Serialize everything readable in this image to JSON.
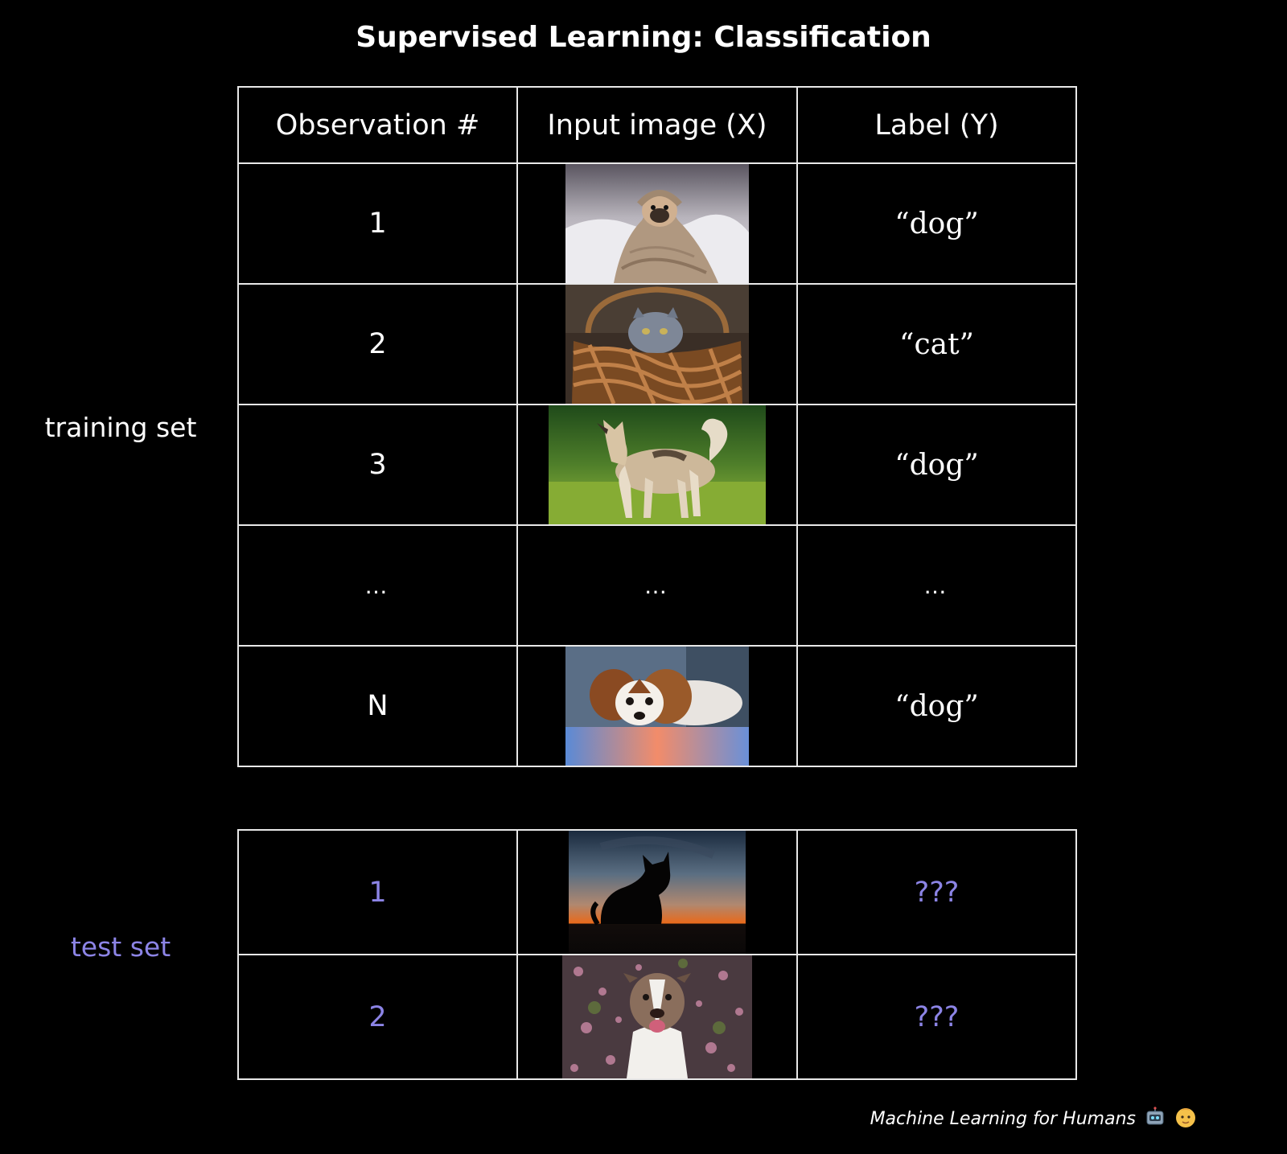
{
  "title": "Supervised Learning: Classification",
  "side_labels": {
    "training": "training set",
    "test": "test set"
  },
  "headers": {
    "observation": "Observation #",
    "input": "Input image (X)",
    "label": "Label (Y)"
  },
  "training_rows": [
    {
      "obs": "1",
      "image": "pug-in-blanket-photo",
      "label": "“dog”"
    },
    {
      "obs": "2",
      "image": "kitten-in-basket-photo",
      "label": "“cat”"
    },
    {
      "obs": "3",
      "image": "husky-on-grass-photo",
      "label": "“dog”"
    },
    {
      "obs": "…",
      "image": "…",
      "label": "…"
    },
    {
      "obs": "N",
      "image": "spaniel-puppy-photo",
      "label": "“dog”"
    }
  ],
  "test_rows": [
    {
      "obs": "1",
      "image": "cat-silhouette-sunset-photo",
      "label": "???"
    },
    {
      "obs": "2",
      "image": "pitbull-in-petals-photo",
      "label": "???"
    }
  ],
  "credit": "Machine Learning for Humans",
  "colors": {
    "background": "#000000",
    "text": "#ffffff",
    "test_accent": "#8c84e6",
    "grid": "#e8e8e8"
  }
}
